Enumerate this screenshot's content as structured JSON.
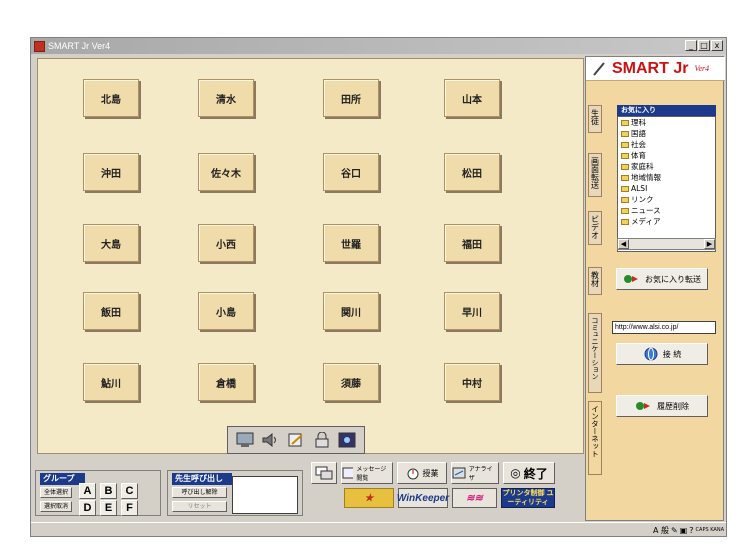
{
  "window": {
    "title": "SMART Jr Ver4",
    "min": "_",
    "max": "□",
    "close": "x"
  },
  "seats": [
    {
      "name": "北島"
    },
    {
      "name": "清水"
    },
    {
      "name": "田所"
    },
    {
      "name": "山本"
    },
    {
      "name": "沖田"
    },
    {
      "name": "佐々木"
    },
    {
      "name": "谷口"
    },
    {
      "name": "松田"
    },
    {
      "name": "大島"
    },
    {
      "name": "小西"
    },
    {
      "name": "世羅"
    },
    {
      "name": "福田"
    },
    {
      "name": "飯田"
    },
    {
      "name": "小島"
    },
    {
      "name": "関川"
    },
    {
      "name": "早川"
    },
    {
      "name": "鮎川"
    },
    {
      "name": "倉橋"
    },
    {
      "name": "須藤"
    },
    {
      "name": "中村"
    }
  ],
  "group": {
    "label": "グループ",
    "select_all": "全体選択",
    "deselect": "選択取消",
    "letters": [
      "A",
      "B",
      "C",
      "D",
      "E",
      "F"
    ]
  },
  "call": {
    "label": "先生呼び出し",
    "release": "呼び出し解除",
    "reset": "リセット"
  },
  "actions": {
    "message": "メッセージ 閲覧",
    "lesson": "授業",
    "analyzer": "アナライザ",
    "exit": "終了"
  },
  "logos": {
    "winkeeper": "WinKeeper",
    "printer": "プリンタ制御 ユーティリティ"
  },
  "brand": {
    "name": "SMART Jr",
    "sub": "Ver4"
  },
  "tabs": [
    "生徒",
    "画面転送",
    "ビデオ",
    "教材",
    "コミュニケーション",
    "インターネット"
  ],
  "favorites": {
    "header": "お気に入り",
    "items": [
      "理科",
      "国語",
      "社会",
      "体育",
      "家庭科",
      "地域情報",
      "ALSI",
      "リンク",
      "ニュース",
      "メディア"
    ]
  },
  "fav_transfer": "お気に入り転送",
  "url": "http://www.alsi.co.jp/",
  "connect": "接 続",
  "history_delete": "履歴削除",
  "tray": {
    "ime": "A 般",
    "caps": "CAPS KANA"
  }
}
